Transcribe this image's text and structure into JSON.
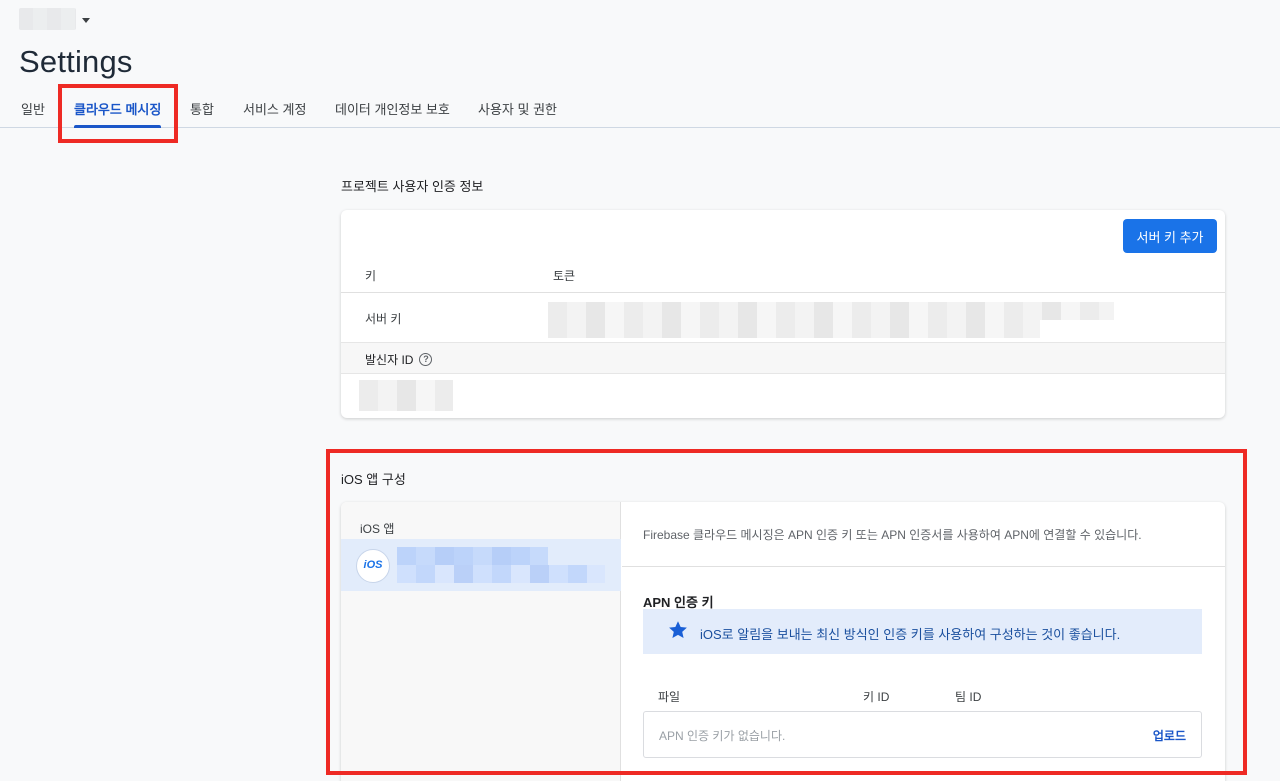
{
  "header": {
    "title": "Settings"
  },
  "tabs": [
    {
      "label": "일반",
      "active": false
    },
    {
      "label": "클라우드 메시징",
      "active": true
    },
    {
      "label": "통합",
      "active": false
    },
    {
      "label": "서비스 계정",
      "active": false
    },
    {
      "label": "데이터 개인정보 보호",
      "active": false
    },
    {
      "label": "사용자 및 권한",
      "active": false
    }
  ],
  "credentials": {
    "section_title": "프로젝트 사용자 인증 정보",
    "add_server_key_label": "서버 키 추가",
    "col_key": "키",
    "col_token": "토큰",
    "server_key_label": "서버 키",
    "sender_id_label": "발신자 ID",
    "help_icon": "help-circle-icon"
  },
  "ios": {
    "section_title": "iOS 앱 구성",
    "apps_title": "iOS 앱",
    "app_badge": "iOS",
    "description": "Firebase 클라우드 메시징은 APN 인증 키 또는 APN 인증서를 사용하여 APN에 연결할 수 있습니다.",
    "apn_title": "APN 인증 키",
    "apn_info_icon": "star-icon",
    "apn_info_text": "iOS로 알림을 보내는 최신 방식인 인증 키를 사용하여 구성하는 것이 좋습니다.",
    "col_file": "파일",
    "col_key_id": "키 ID",
    "col_team_id": "팀 ID",
    "empty_text": "APN 인증 키가 없습니다.",
    "upload_label": "업로드"
  },
  "colors": {
    "accent": "#1a73e8",
    "active_tab": "#1a56c8",
    "highlight_red": "#ee2a24",
    "info_bg": "#e3ecfb"
  }
}
